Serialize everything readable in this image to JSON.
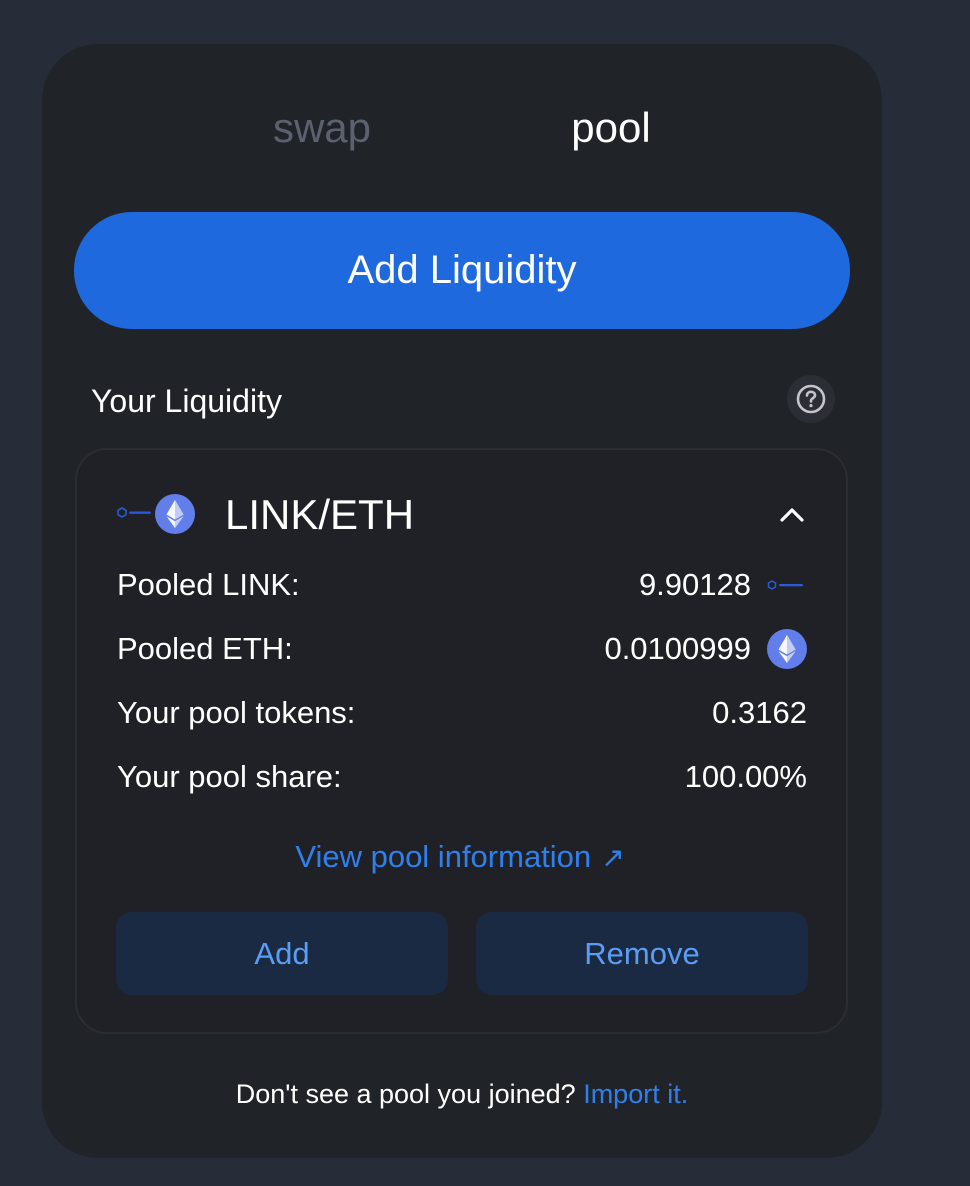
{
  "tabs": [
    {
      "label": "swap",
      "active": false
    },
    {
      "label": "pool",
      "active": true
    }
  ],
  "add_liquidity_label": "Add Liquidity",
  "your_liquidity": {
    "title": "Your Liquidity",
    "help_icon": "question-circle-icon"
  },
  "position": {
    "pair": "LINK/ETH",
    "token0_icon": "chainlink-logo-icon",
    "token1_icon": "ethereum-logo-icon",
    "expanded": true,
    "rows": [
      {
        "label": "Pooled LINK:",
        "value": "9.90128"
      },
      {
        "label": "Pooled ETH:",
        "value": "0.0100999"
      },
      {
        "label": "Your pool tokens:",
        "value": "0.3162"
      },
      {
        "label": "Your pool share:",
        "value": "100.00%"
      }
    ],
    "view_link": "View pool information",
    "view_link_icon": "arrow-up-right-icon",
    "add_label": "Add",
    "remove_label": "Remove"
  },
  "footer": {
    "text": "Don't see a pool you joined?",
    "link": "Import it."
  },
  "colors": {
    "background": "#262c38",
    "card": "#202327",
    "primary": "#1f69df",
    "link": "#2f80ed",
    "secondary_button_bg": "#1b2a43",
    "secondary_button_text": "#5c9df4",
    "inactive_tab": "#5c6170",
    "eth_logo": "#627eea",
    "chainlink_logo": "#2a5ada"
  }
}
